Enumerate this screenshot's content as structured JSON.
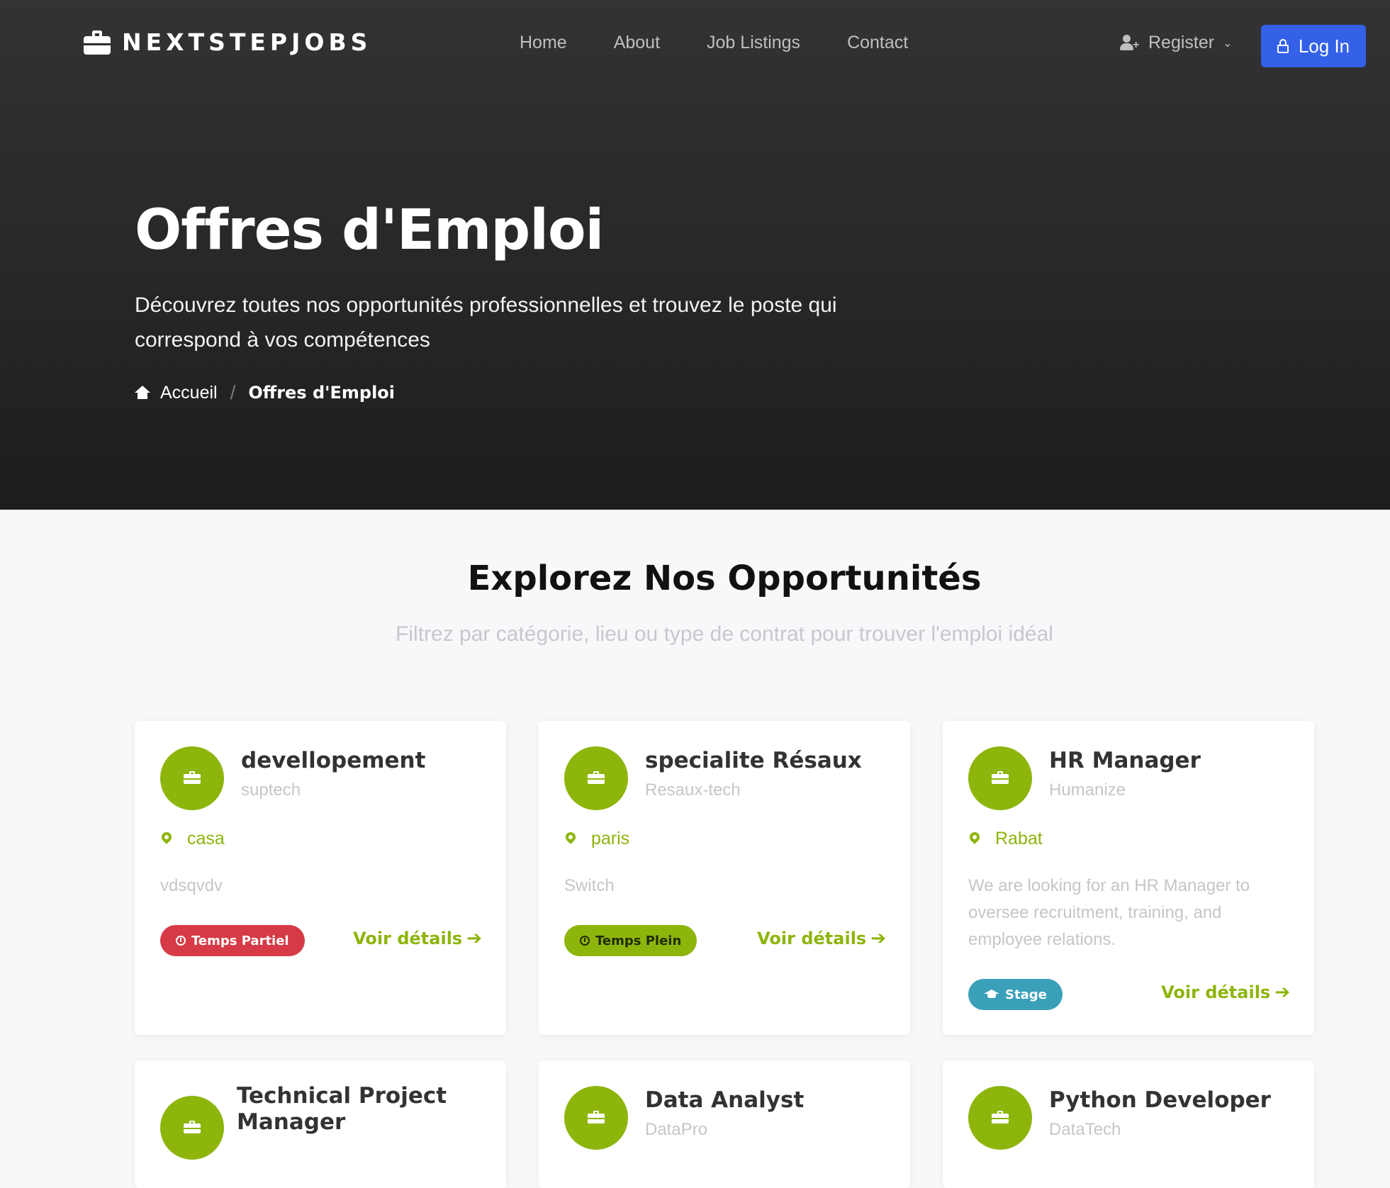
{
  "brand": {
    "name": "NEXTSTEPJOBS",
    "icon": "briefcase-icon"
  },
  "nav": {
    "links": [
      "Home",
      "About",
      "Job Listings",
      "Contact"
    ],
    "register_label": "Register",
    "login_label": "Log In"
  },
  "hero": {
    "title": "Offres d'Emploi",
    "subtitle": "Découvrez toutes nos opportunités professionnelles et trouvez le poste qui correspond à vos compétences",
    "breadcrumb": {
      "home": "Accueil",
      "separator": "/",
      "current": "Offres d'Emploi"
    }
  },
  "section": {
    "title": "Explorez Nos Opportunités",
    "subtitle": "Filtrez par catégorie, lieu ou type de contrat pour trouver l'emploi idéal"
  },
  "jobs": [
    {
      "title": "devellopement",
      "company": "suptech",
      "location": "casa",
      "description": "vdsqvdv",
      "type": "Temps Partiel",
      "type_color": "#d63a46"
    },
    {
      "title": "specialite Résaux",
      "company": "Resaux-tech",
      "location": "paris",
      "description": "Switch",
      "type": "Temps Plein",
      "type_color": "#8db50c"
    },
    {
      "title": "HR Manager",
      "company": "Humanize",
      "location": "Rabat",
      "description": "We are looking for an HR Manager to oversee recruitment, training, and employee relations.",
      "type": "Stage",
      "type_color": "#3aa0b9"
    },
    {
      "title": "Technical Project Manager",
      "company": "",
      "location": "",
      "description": "",
      "type": ""
    },
    {
      "title": "Data Analyst",
      "company": "DataPro",
      "location": "",
      "description": "",
      "type": ""
    },
    {
      "title": "Python Developer",
      "company": "DataTech",
      "location": "",
      "description": "",
      "type": ""
    }
  ],
  "details_label": "Voir détails",
  "colors": {
    "accent": "#8db50c",
    "primary": "#3461e8",
    "hero_bg": "#2a2a2c"
  }
}
